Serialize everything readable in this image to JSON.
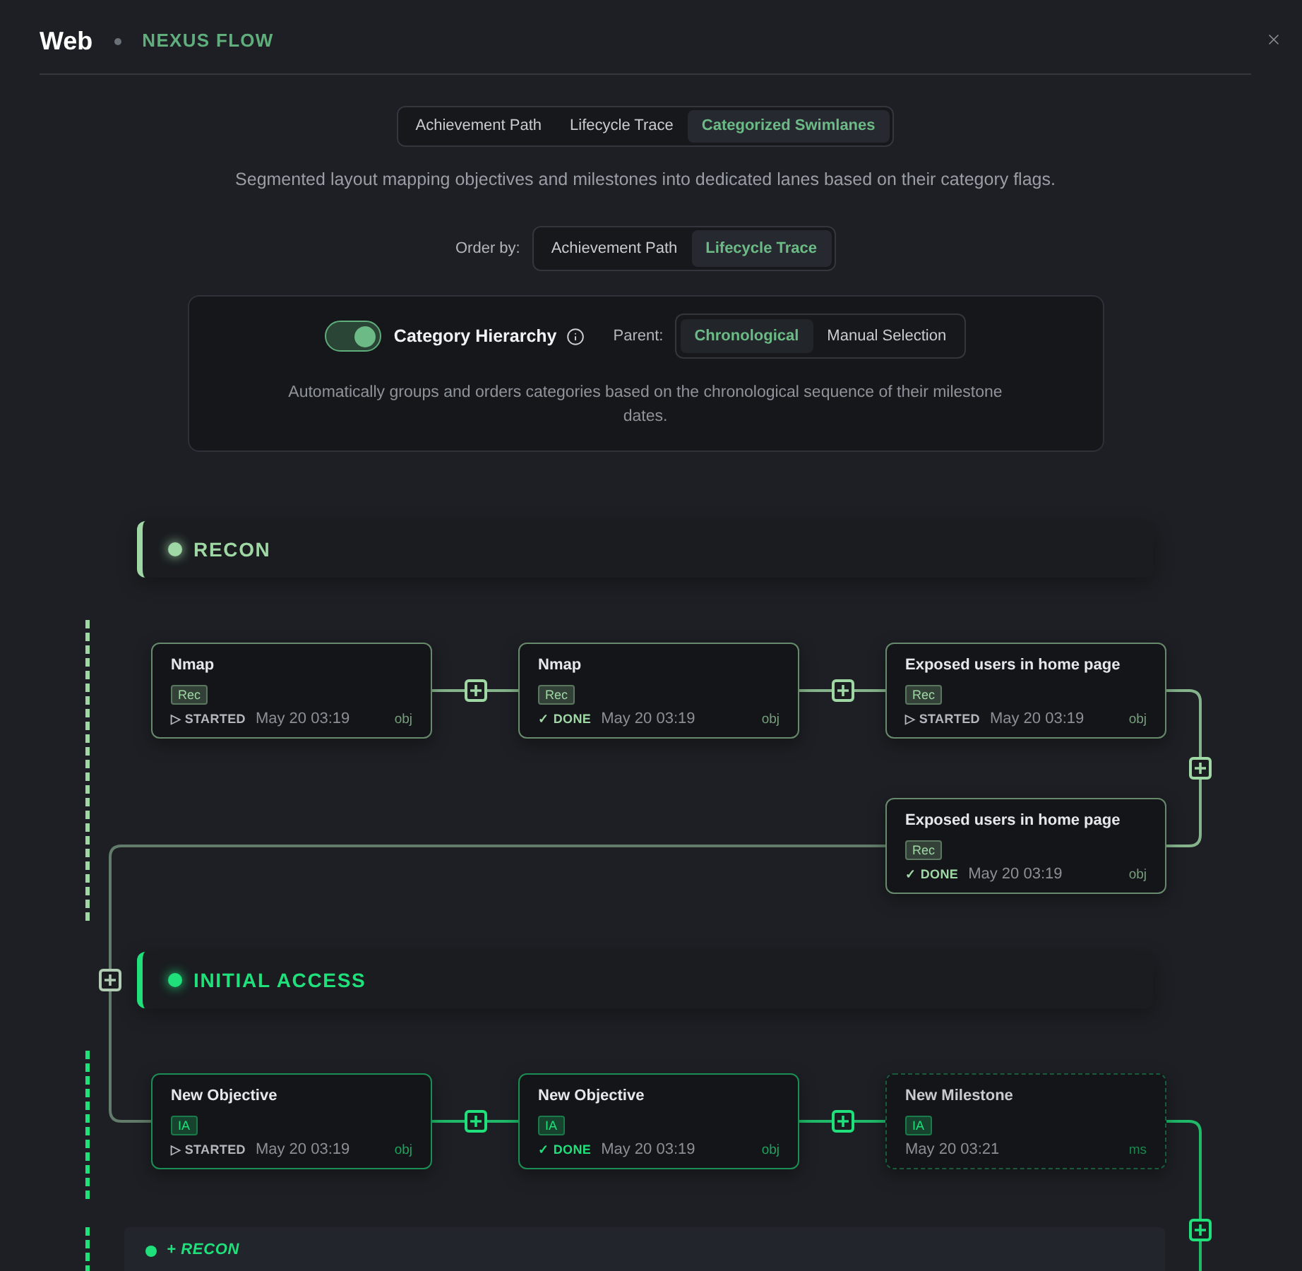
{
  "header": {
    "title": "Web",
    "subtitle": "NEXUS FLOW"
  },
  "view_tabs": [
    {
      "label": "Achievement Path",
      "selected": false
    },
    {
      "label": "Lifecycle Trace",
      "selected": false
    },
    {
      "label": "Categorized Swimlanes",
      "selected": true
    }
  ],
  "view_description": "Segmented layout mapping objectives and milestones into dedicated lanes based on their category flags.",
  "order_by": {
    "label": "Order by:",
    "options": [
      {
        "label": "Achievement Path",
        "selected": false
      },
      {
        "label": "Lifecycle Trace",
        "selected": true
      }
    ]
  },
  "hierarchy_panel": {
    "toggle": {
      "label": "Category Hierarchy",
      "on": true
    },
    "parent": {
      "label": "Parent:",
      "options": [
        {
          "label": "Chronological",
          "selected": true
        },
        {
          "label": "Manual Selection",
          "selected": false
        }
      ]
    },
    "description": "Automatically groups and orders categories based on the chronological sequence of their milestone dates."
  },
  "lanes": [
    {
      "title": "RECON",
      "color": "#9fd8a5",
      "nodes": [
        {
          "kind": "objective",
          "title": "Nmap",
          "tag": "Rec",
          "status": {
            "kind": "started",
            "label": "▷ STARTED"
          },
          "date": "May 20 03:19",
          "type_label": "obj"
        },
        {
          "kind": "objective",
          "title": "Nmap",
          "tag": "Rec",
          "status": {
            "kind": "done",
            "label": "✓ DONE"
          },
          "date": "May 20 03:19",
          "type_label": "obj"
        },
        {
          "kind": "objective",
          "title": "Exposed users in home page",
          "tag": "Rec",
          "status": {
            "kind": "started",
            "label": "▷ STARTED"
          },
          "date": "May 20 03:19",
          "type_label": "obj"
        },
        {
          "kind": "objective",
          "title": "Exposed users in home page",
          "tag": "Rec",
          "status": {
            "kind": "done",
            "label": "✓ DONE"
          },
          "date": "May 20 03:19",
          "type_label": "obj"
        }
      ]
    },
    {
      "title": "INITIAL ACCESS",
      "color": "#1fe07a",
      "nodes": [
        {
          "kind": "objective",
          "title": "New Objective",
          "tag": "IA",
          "status": {
            "kind": "started",
            "label": "▷ STARTED"
          },
          "date": "May 20 03:19",
          "type_label": "obj"
        },
        {
          "kind": "objective",
          "title": "New Objective",
          "tag": "IA",
          "status": {
            "kind": "done",
            "label": "✓ DONE"
          },
          "date": "May 20 03:19",
          "type_label": "obj"
        },
        {
          "kind": "milestone",
          "title": "New Milestone",
          "tag": "IA",
          "date": "May 20 03:21",
          "type_label": "ms"
        }
      ]
    }
  ],
  "next_lane": {
    "title": "+ RECON",
    "color": "#1fe07a"
  }
}
